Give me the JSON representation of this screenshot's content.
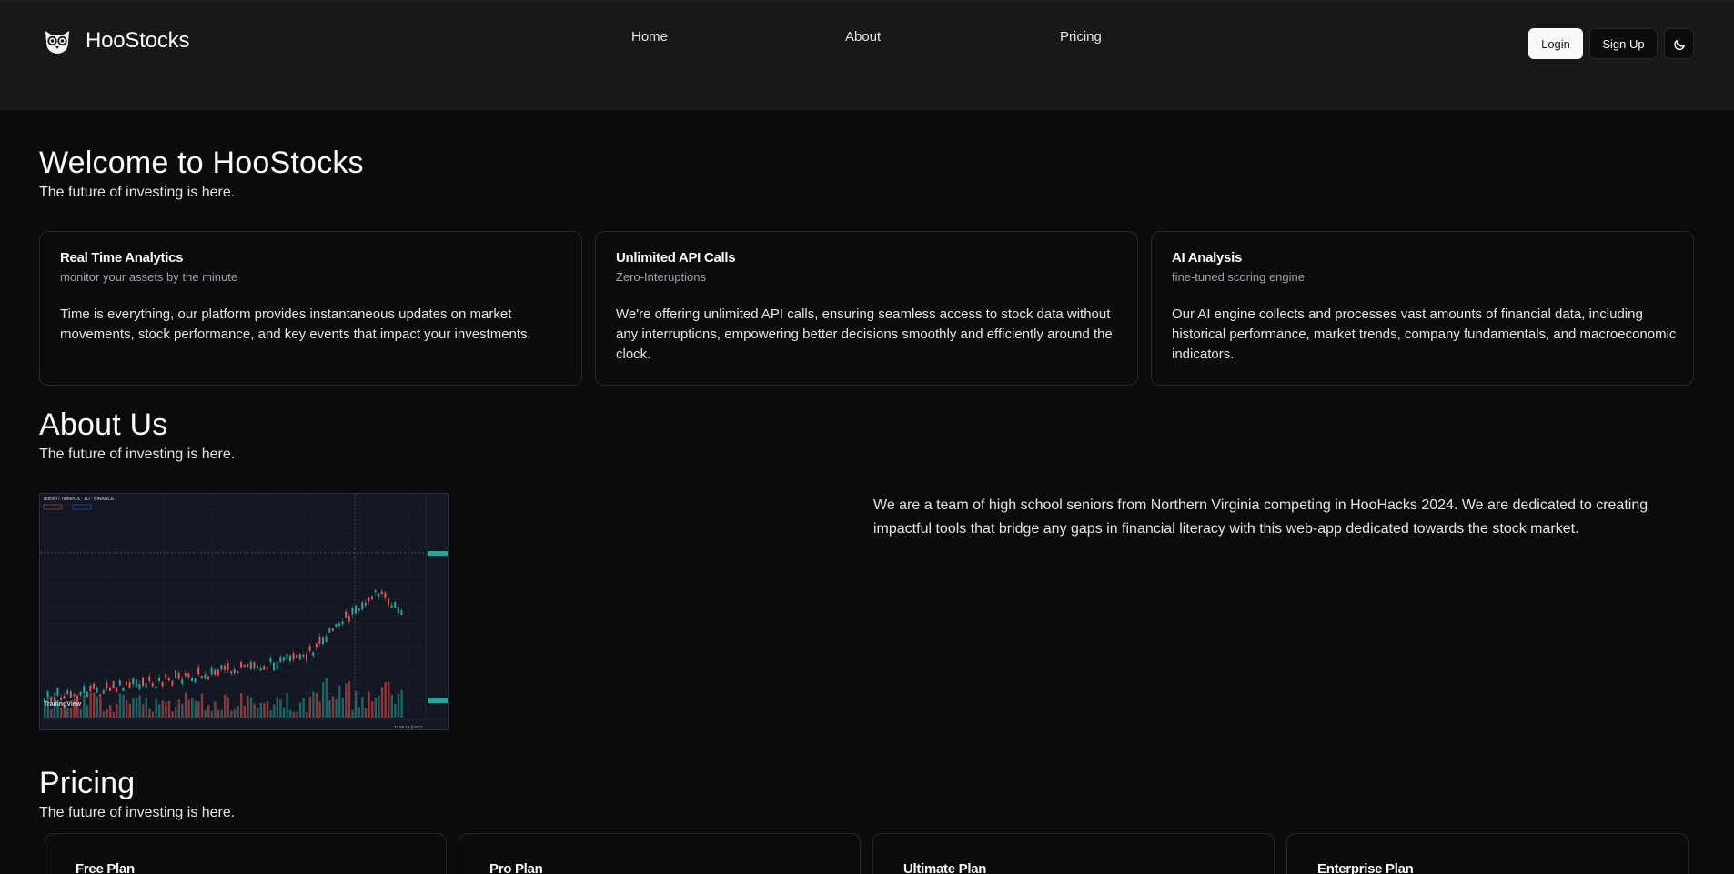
{
  "brand": {
    "name": "HooStocks",
    "logo_icon": "owl-icon"
  },
  "nav": {
    "home": "Home",
    "about": "About",
    "pricing": "Pricing"
  },
  "auth": {
    "login": "Login",
    "signup": "Sign Up",
    "theme_icon": "moon-icon"
  },
  "hero": {
    "title": "Welcome to HooStocks",
    "subtitle": "The future of investing is here."
  },
  "features": [
    {
      "title": "Real Time Analytics",
      "subtitle": "monitor your assets by the minute",
      "body": "Time is everything, our platform provides instantaneous updates on market movements, stock performance, and key events that impact your investments."
    },
    {
      "title": "Unlimited API Calls",
      "subtitle": "Zero-Interuptions",
      "body": "We're offering unlimited API calls, ensuring seamless access to stock data without any interruptions, empowering better decisions smoothly and efficiently around the clock."
    },
    {
      "title": "AI Analysis",
      "subtitle": "fine-tuned scoring engine",
      "body": "Our AI engine collects and processes vast amounts of financial data, including historical performance, market trends, company fundamentals, and macroeconomic indicators."
    }
  ],
  "about": {
    "title": "About Us",
    "subtitle": "The future of investing is here.",
    "body": "We are a team of high school seniors from Northern Virginia competing in HooHacks 2024. We are dedicated to creating impactful tools that bridge any gaps in financial literacy with this web-app dedicated towards the stock market.",
    "chart_image": {
      "header": "Bitcoin / TetherUS · 1D · BINANCE",
      "watermark": "TradingView",
      "time_label": "23:55:16 (UTC)",
      "colors": {
        "up": "#26a69a",
        "down": "#ef5350",
        "bg": "#131722"
      }
    }
  },
  "pricing": {
    "title": "Pricing",
    "subtitle": "The future of investing is here.",
    "plans": [
      {
        "name": "Free Plan"
      },
      {
        "name": "Pro Plan"
      },
      {
        "name": "Ultimate Plan"
      },
      {
        "name": "Enterprise Plan"
      }
    ]
  }
}
